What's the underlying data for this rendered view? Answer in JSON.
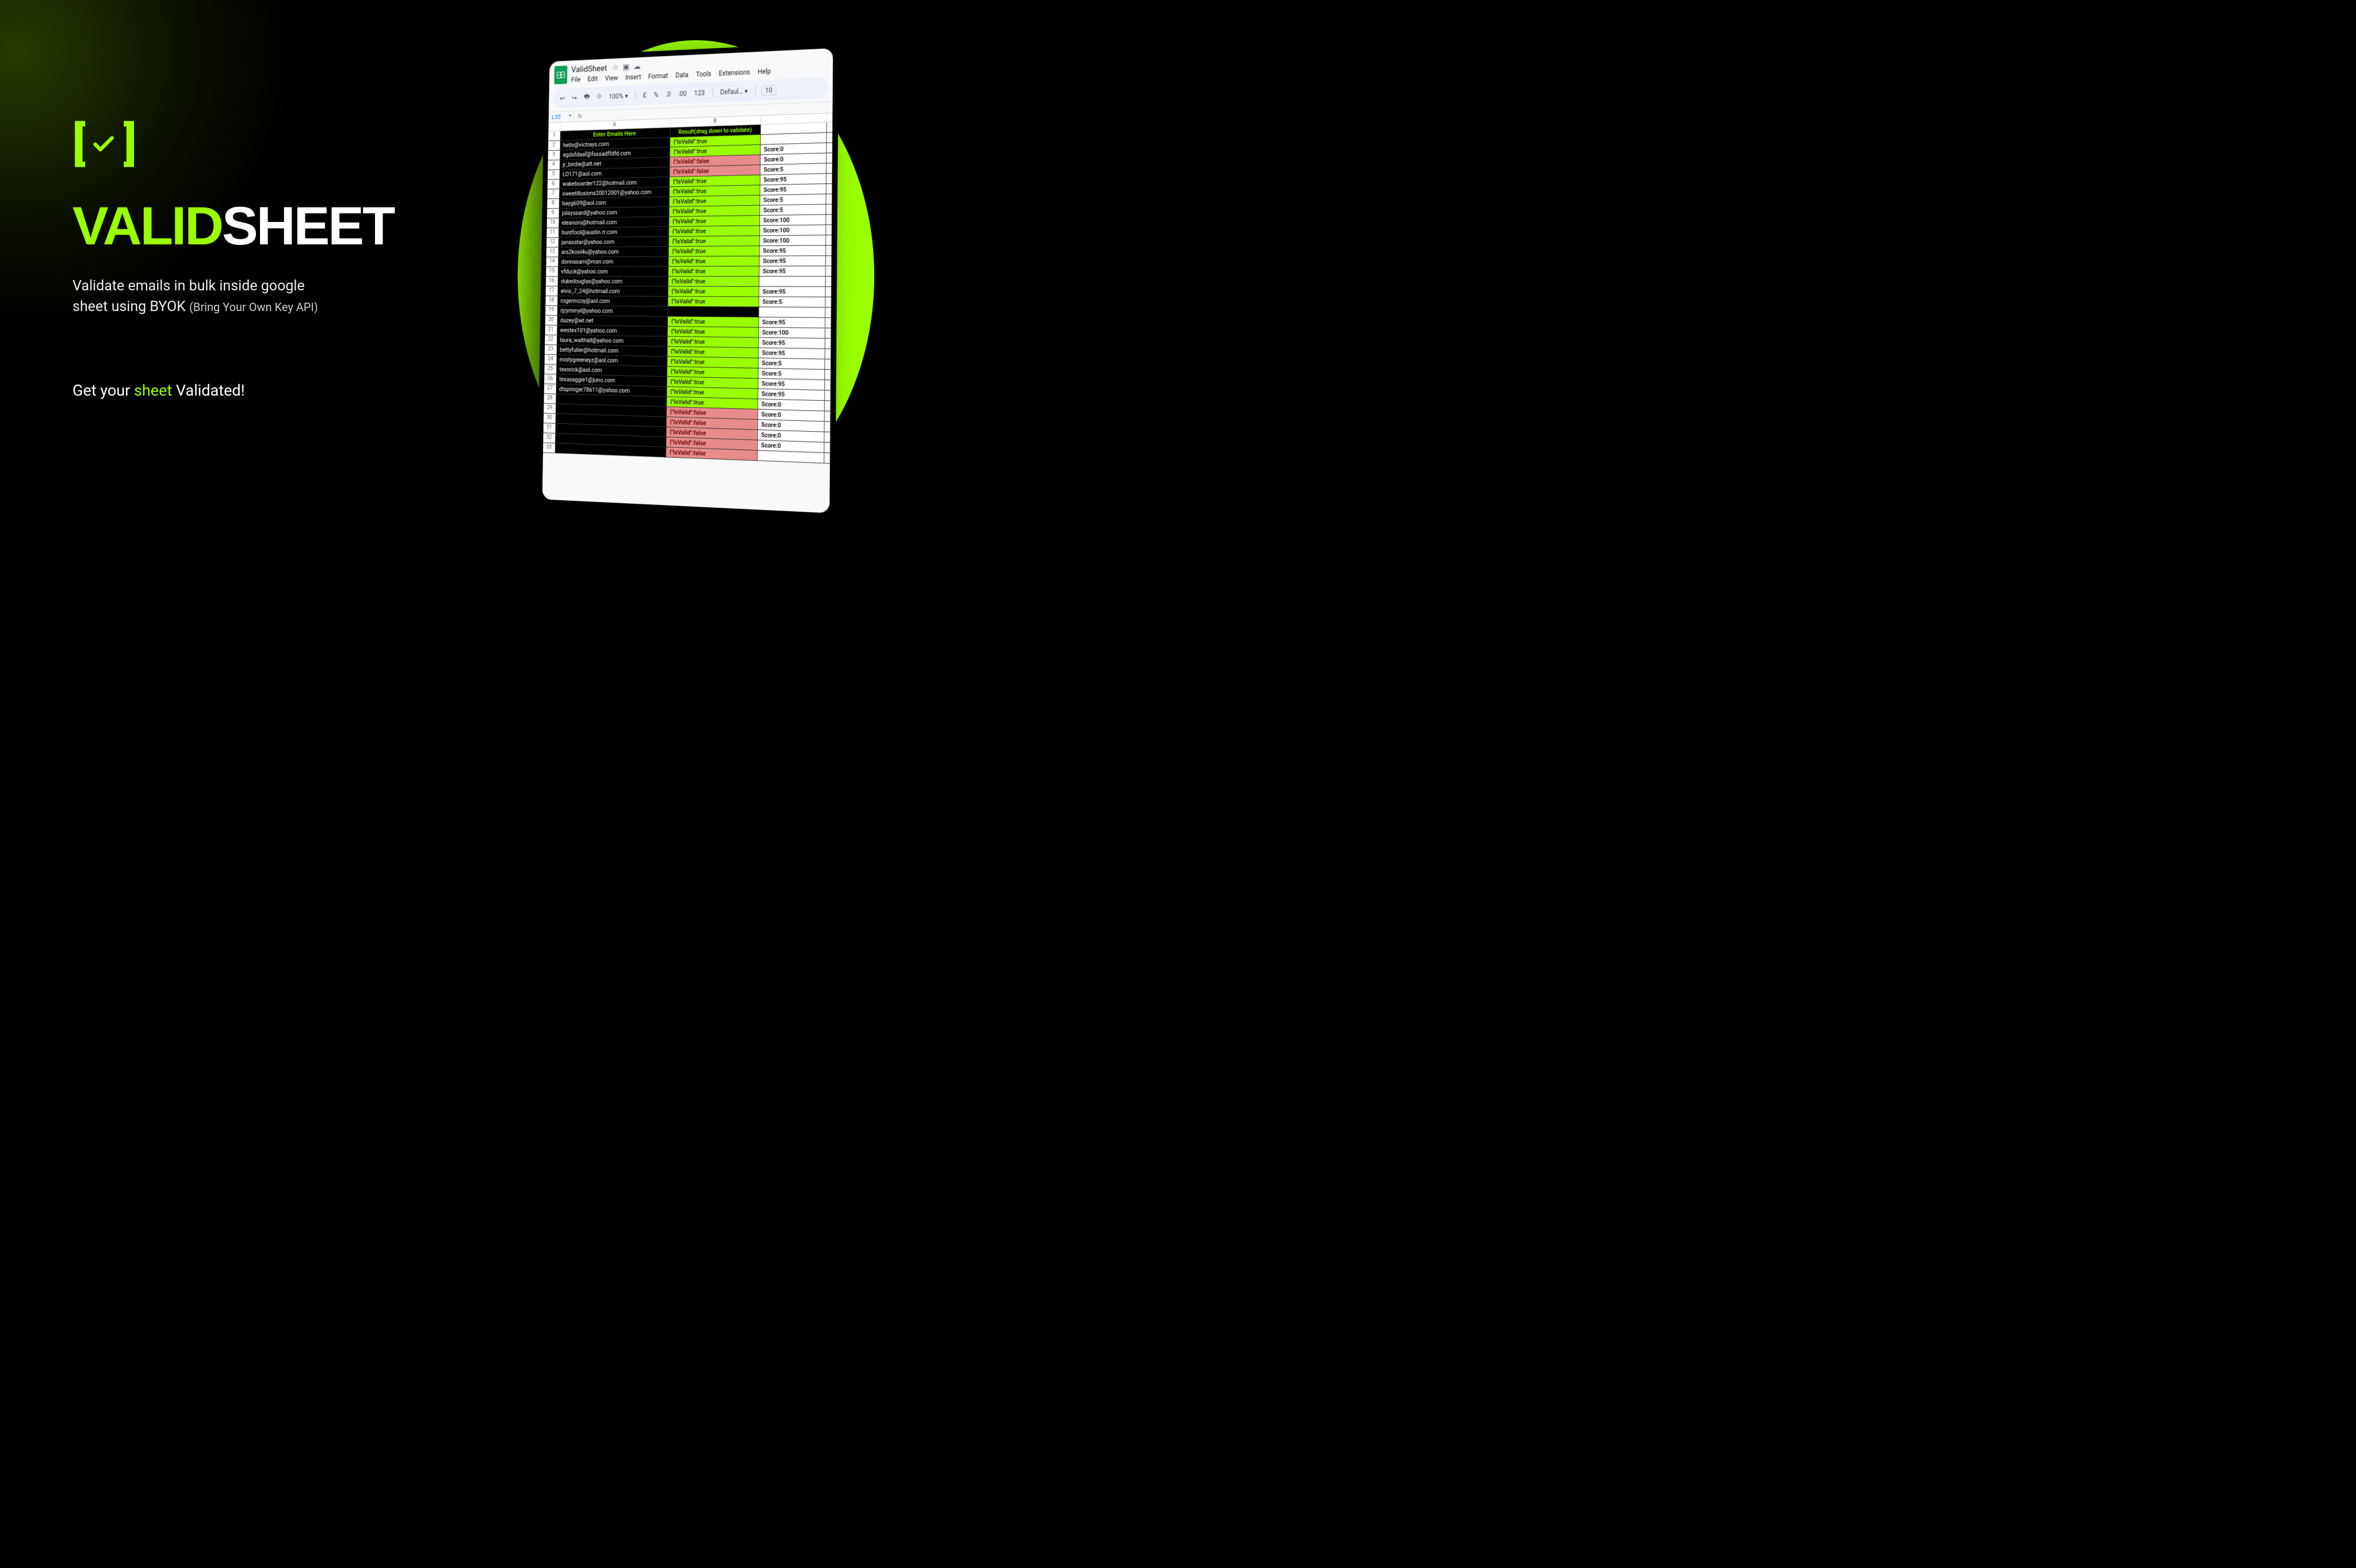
{
  "hero": {
    "brand_valid": "VALID",
    "brand_sheet": "SHEET",
    "sub_line1": "Validate emails in bulk inside google",
    "sub_line2_a": "sheet using BYOK ",
    "sub_line2_b": "(Bring Your Own Key API)",
    "cta_a": "Get your ",
    "cta_hi": "sheet",
    "cta_b": " Validated!"
  },
  "sheet": {
    "doc_title": "ValidSheet",
    "menus": [
      "File",
      "Edit",
      "View",
      "Insert",
      "Format",
      "Data",
      "Tools",
      "Extensions",
      "Help"
    ],
    "toolbar": {
      "zoom": "100%",
      "currency": "£",
      "pct": "%",
      "dec1": ".0",
      "dec2": ".00",
      "fmt": "123",
      "font": "Defaul…",
      "size": "10"
    },
    "namebox": "L33",
    "col_headers": [
      "",
      "A",
      "B",
      ""
    ],
    "header_row": {
      "a": "Enter Emails Here",
      "b": "Result(drag down to validate)"
    },
    "rows": [
      {
        "n": 2,
        "email": "hello@victrays.com",
        "valid": true,
        "score": ""
      },
      {
        "n": 3,
        "email": "egdsfdaaf@fsssadffdfd.com",
        "valid": true,
        "score": "Score:0"
      },
      {
        "n": 4,
        "email": "jr_birdie@att.net",
        "valid": false,
        "score": "Score:0"
      },
      {
        "n": 5,
        "email": "LO171@aol.com",
        "valid": false,
        "score": "Score:5"
      },
      {
        "n": 6,
        "email": "wakeboarder122@hotmail.com",
        "valid": true,
        "score": "Score:95"
      },
      {
        "n": 7,
        "email": "sweetillusions20012001@yahoo.com",
        "valid": true,
        "score": "Score:95"
      },
      {
        "n": 8,
        "email": "bayg609@aol.com",
        "valid": true,
        "score": "Score:5"
      },
      {
        "n": 9,
        "email": "jolayssard@yahoo.com",
        "valid": true,
        "score": "Score:5"
      },
      {
        "n": 10,
        "email": "eleanoro@hotmail.com",
        "valid": true,
        "score": "Score:100"
      },
      {
        "n": 11,
        "email": "huntfool@austin.rr.com",
        "valid": true,
        "score": "Score:100"
      },
      {
        "n": 12,
        "email": "janasstar@yahoo.com",
        "valid": true,
        "score": "Score:100"
      },
      {
        "n": 13,
        "email": "ars2kool4u@yahoo.com",
        "valid": true,
        "score": "Score:95"
      },
      {
        "n": 14,
        "email": "donnasam@msn.com",
        "valid": true,
        "score": "Score:95"
      },
      {
        "n": 15,
        "email": "vfduck@yahoo.com",
        "valid": true,
        "score": "Score:95"
      },
      {
        "n": 16,
        "email": "dukedouglas@yahoo.com",
        "valid": true,
        "score": ""
      },
      {
        "n": 17,
        "email": "elvis_7_24@hotmail.com",
        "valid": true,
        "score": "Score:95"
      },
      {
        "n": 18,
        "email": "rogermcoy@aol.com",
        "valid": true,
        "score": "Score:5"
      },
      {
        "n": 19,
        "email": "rjzymmyl@yahoo.com",
        "valid": null,
        "score": ""
      },
      {
        "n": 20,
        "email": "dazey@wt.net",
        "valid": true,
        "score": "Score:95"
      },
      {
        "n": 21,
        "email": "westex101@yahoo.com",
        "valid": true,
        "score": "Score:100"
      },
      {
        "n": 22,
        "email": "laura_walthall@yahoo.com",
        "valid": true,
        "score": "Score:95"
      },
      {
        "n": 23,
        "email": "bettyfuller@hotmail.com",
        "valid": true,
        "score": "Score:95"
      },
      {
        "n": 24,
        "email": "mistygreeneyz@aol.com",
        "valid": true,
        "score": "Score:5"
      },
      {
        "n": 25,
        "email": "texnrick@aol.com",
        "valid": true,
        "score": "Score:5"
      },
      {
        "n": 26,
        "email": "texasaggie1@juno.com",
        "valid": true,
        "score": "Score:95"
      },
      {
        "n": 27,
        "email": "dtspringer78611@yahoo.com",
        "valid": true,
        "score": "Score:95"
      },
      {
        "n": 28,
        "email": "",
        "valid": true,
        "score": "Score:0"
      },
      {
        "n": 29,
        "email": "",
        "valid": false,
        "score": "Score:0"
      },
      {
        "n": 30,
        "email": "",
        "valid": false,
        "score": "Score:0"
      },
      {
        "n": 31,
        "email": "",
        "valid": false,
        "score": "Score:0"
      },
      {
        "n": 32,
        "email": "",
        "valid": false,
        "score": "Score:0"
      },
      {
        "n": 33,
        "email": "",
        "valid": false,
        "score": ""
      }
    ],
    "true_label": "{\"IsValid\":true",
    "false_label": "{\"IsValid\":false"
  }
}
